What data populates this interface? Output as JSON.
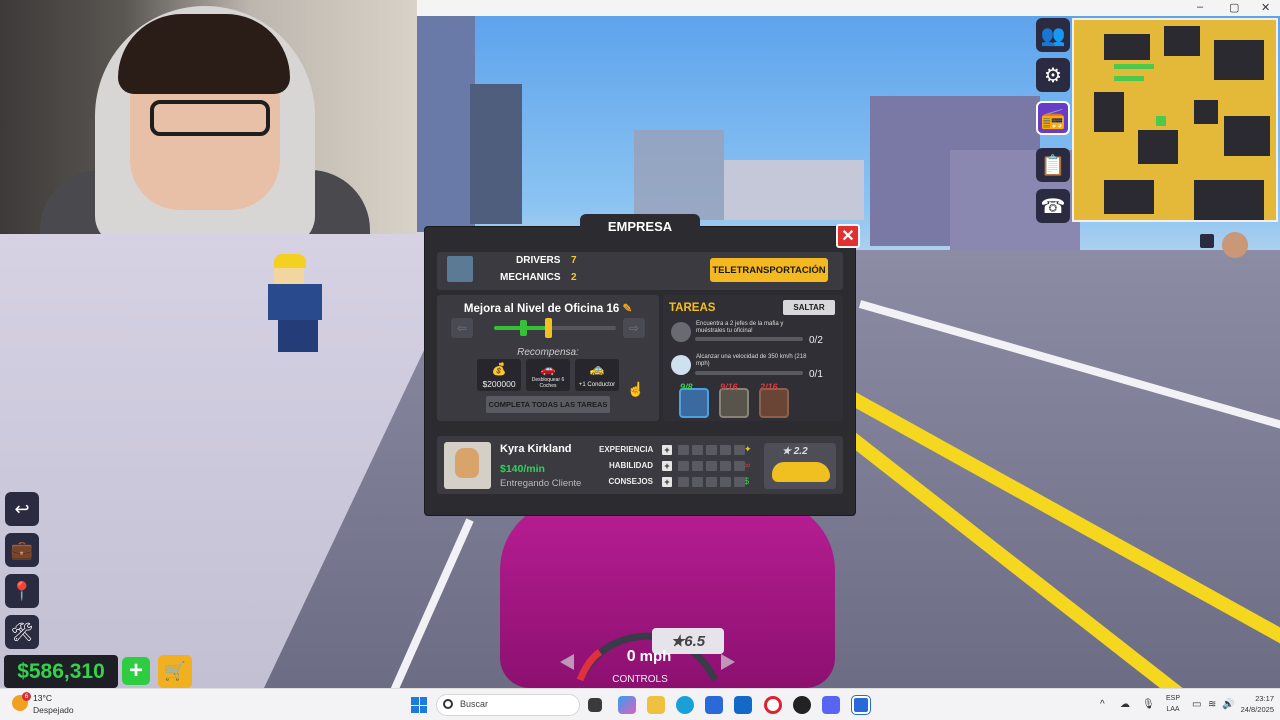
{
  "window": {
    "controls": [
      "–",
      "▢",
      "✕"
    ]
  },
  "modal": {
    "title": "EMPRESA",
    "close_label": "✕",
    "drivers_label": "DRIVERS",
    "drivers_count": "7",
    "mechanics_label": "MECHANICS",
    "mechanics_count": "2",
    "teleport_label": "TELETRANSPORTACIÓN",
    "upgrade": {
      "title": "Mejora al Nivel de Oficina 16",
      "progress": 0.45,
      "reward_label": "Recompensa:",
      "rewards": [
        {
          "icon": "money-bag-icon",
          "glyph": "💰",
          "text": "$200000"
        },
        {
          "icon": "car-icon",
          "glyph": "🚗",
          "text": "Desbloquear 6 Coches"
        },
        {
          "icon": "taxi-icon",
          "glyph": "🚕",
          "text": "+1 Conductor"
        }
      ],
      "complete_label": "COMPLETA TODAS LAS TAREAS"
    },
    "tasks": {
      "title": "TAREAS",
      "skip_label": "SALTAR",
      "items": [
        {
          "text": "Encuentra a 2 jefes de la mafia y muéstrales tu oficina!",
          "count": "0/2",
          "progress": 0
        },
        {
          "text": "Alcanzar una velocidad de 350 km/h (218 mph)",
          "count": "0/1",
          "progress": 0
        }
      ],
      "materials": [
        {
          "name": "glass-material",
          "count": "9/8",
          "color": "#4aa2e0",
          "count_color": "#3ad24a"
        },
        {
          "name": "stone-material",
          "count": "9/16",
          "color": "#e4dcc4",
          "count_color": "#e03a3a"
        },
        {
          "name": "wood-material",
          "count": "2/16",
          "color": "#c8784a",
          "count_color": "#e03a3a"
        }
      ]
    },
    "employee": {
      "name": "Kyra Kirkland",
      "rate": "$140/min",
      "status": "Entregando Cliente",
      "skills": [
        {
          "label": "EXPERIENCIA",
          "icon": "✦",
          "icon_color": "#f4c020"
        },
        {
          "label": "HABILIDAD",
          "icon": "∞",
          "icon_color": "#e03a3a"
        },
        {
          "label": "CONSEJOS",
          "icon": "$",
          "icon_color": "#3ad24a"
        }
      ],
      "car_rating": "2.2"
    }
  },
  "hud": {
    "money": "$586,310",
    "add_label": "+",
    "speed_value": "0",
    "speed_unit": "mph",
    "car_rating": "6.5",
    "controls_label": "CONTROLS"
  },
  "taskbar": {
    "weather_temp": "13°C",
    "weather_desc": "Despejado",
    "weather_badge": "6",
    "search_placeholder": "Buscar",
    "lang_top": "ESP",
    "lang_bottom": "LAA",
    "time": "23:17",
    "date": "24/8/2025"
  },
  "colors": {
    "accent_yellow": "#f4b820",
    "money_green": "#32d24a",
    "close_red": "#e03030",
    "panel_bg": "#2b2b30"
  }
}
